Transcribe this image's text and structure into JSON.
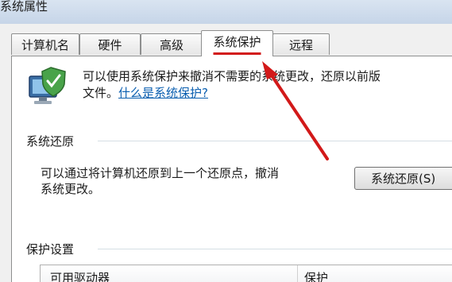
{
  "window": {
    "title": "系统属性"
  },
  "tabs": [
    {
      "label": "计算机名"
    },
    {
      "label": "硬件"
    },
    {
      "label": "高级"
    },
    {
      "label": "系统保护"
    },
    {
      "label": "远程"
    }
  ],
  "intro": {
    "line1": "可以使用系统保护来撤消不需要的系统更改，还原以前版",
    "line2_prefix": "文件。",
    "help_link": "什么是系统保护?"
  },
  "system_restore": {
    "heading": "系统还原",
    "desc_line1": "可以通过将计算机还原到上一个还原点，撤消",
    "desc_line2": "系统更改。",
    "button_label": "系统还原(S)"
  },
  "protection_settings": {
    "heading": "保护设置",
    "columns": [
      "可用驱动器",
      "保护"
    ]
  },
  "icons": {
    "app": "computer-shield-icon",
    "annotation": "red-arrow"
  },
  "colors": {
    "annotation_red": "#d21919",
    "link_blue": "#0b5fb0"
  }
}
